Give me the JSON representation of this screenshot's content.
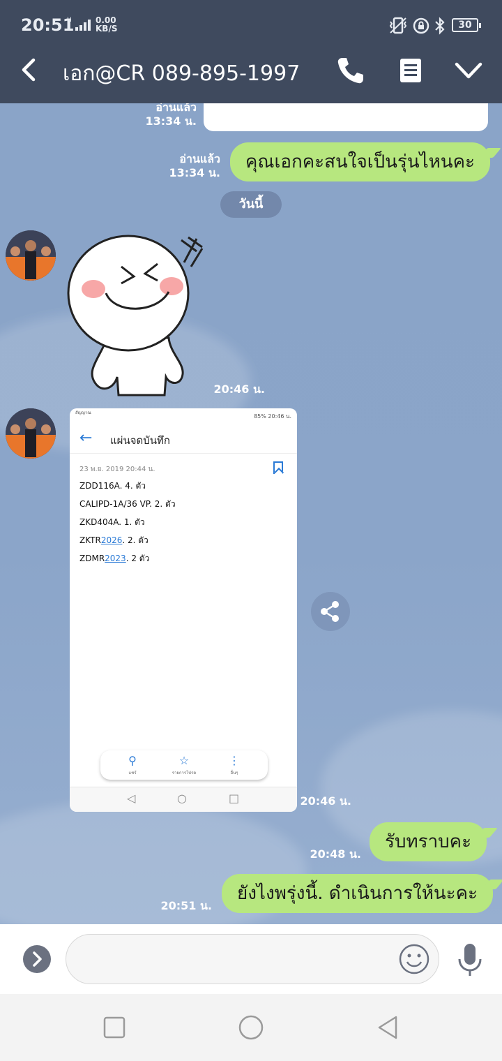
{
  "status_bar": {
    "time": "20:51",
    "network": "H",
    "speed_value": "0.00",
    "speed_unit": "KB/S",
    "battery": "30",
    "icons": [
      "vibrate-icon",
      "lock-rotation-icon",
      "bluetooth-icon"
    ]
  },
  "header": {
    "title": "เอก@CR 089-895-1997",
    "icons": [
      "back-icon",
      "phone-icon",
      "memo-icon",
      "chevron-down-icon"
    ]
  },
  "messages": {
    "m1": {
      "read": "อ่านแล้ว",
      "time": "13:34 น."
    },
    "m2": {
      "read": "อ่านแล้ว",
      "time": "13:34 น.",
      "text": "คุณเอกคะสนใจเป็นรุ่นไหนคะ"
    },
    "day_separator": "วันนี้",
    "sticker": {
      "time": "20:46 น."
    },
    "image": {
      "time": "20:46 น."
    },
    "m3": {
      "time": "20:48 น.",
      "text": "รับทราบคะ"
    },
    "m4": {
      "time": "20:51 น.",
      "text": "ยังไงพรุ่งนี้. ดำเนินการให้นะคะ"
    }
  },
  "screenshot": {
    "status_left": "สัญญาณ",
    "status_right": "85% 20:46 น.",
    "title": "แผ่นจดบันทึก",
    "date": "23 พ.ย. 2019 20:44 น.",
    "lines": [
      {
        "text": "ZDD116A.  4. ตัว",
        "pre": "",
        "hl": "",
        "post": ""
      },
      {
        "text": "CALIPD-1A/36 VP. 2. ตัว",
        "pre": "",
        "hl": "",
        "post": ""
      },
      {
        "text": "ZKD404A.  1. ตัว",
        "pre": "",
        "hl": "",
        "post": ""
      },
      {
        "text": "",
        "pre": "ZKTR",
        "hl": "2026",
        "post": ". 2. ตัว"
      },
      {
        "text": "",
        "pre": "ZDMR",
        "hl": "2023",
        "post": ". 2 ตัว"
      }
    ],
    "toolbar": [
      "แชร์",
      "รายการโปรด",
      "อื่นๆ"
    ]
  },
  "input": {
    "placeholder": ""
  },
  "colors": {
    "header_bg": "#3f4a5e",
    "outgoing_bubble": "#b7e77f",
    "chat_bg": "#8aa2c4"
  }
}
